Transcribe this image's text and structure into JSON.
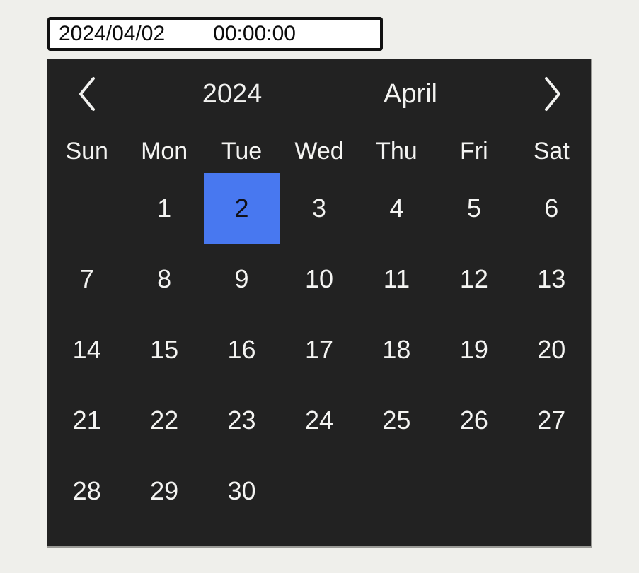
{
  "input": {
    "date_value": "2024/04/02",
    "time_value": "00:00:00"
  },
  "calendar": {
    "prev_icon": "chevron-left-icon",
    "next_icon": "chevron-right-icon",
    "year": "2024",
    "month": "April",
    "weekdays": [
      "Sun",
      "Mon",
      "Tue",
      "Wed",
      "Thu",
      "Fri",
      "Sat"
    ],
    "leading_blanks": 1,
    "days": [
      "1",
      "2",
      "3",
      "4",
      "5",
      "6",
      "7",
      "8",
      "9",
      "10",
      "11",
      "12",
      "13",
      "14",
      "15",
      "16",
      "17",
      "18",
      "19",
      "20",
      "21",
      "22",
      "23",
      "24",
      "25",
      "26",
      "27",
      "28",
      "29",
      "30"
    ],
    "selected_day": "2",
    "colors": {
      "panel_background": "#222222",
      "page_background": "#efefeb",
      "text": "#f4f4f2",
      "selection": "#4878f0",
      "selected_text": "#111118",
      "input_border": "#111111",
      "input_background": "#ffffff"
    }
  }
}
